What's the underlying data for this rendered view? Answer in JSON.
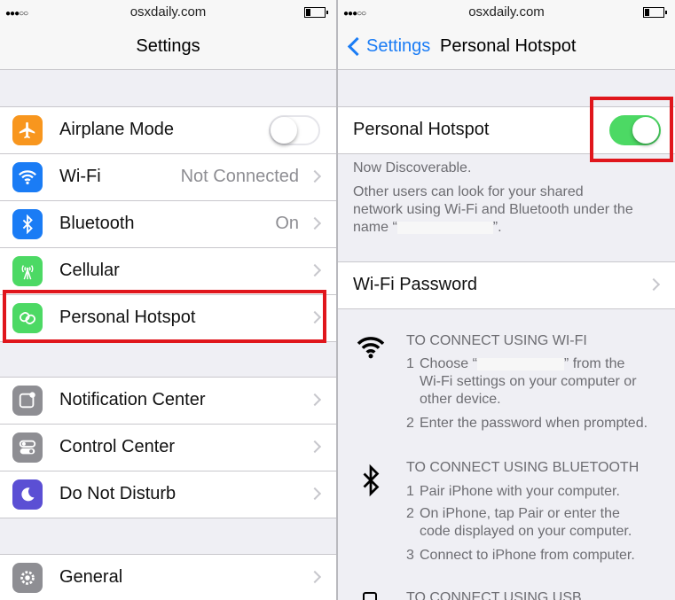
{
  "status": {
    "carrier": "osxdaily.com",
    "signal": "●●●○○"
  },
  "left": {
    "title": "Settings",
    "group1": [
      {
        "label": "Airplane Mode",
        "value": "",
        "icon": "airplane-icon",
        "color": "#f8961e",
        "toggle": true
      },
      {
        "label": "Wi-Fi",
        "value": "Not Connected",
        "icon": "wifi-icon",
        "color": "#1a7cf5"
      },
      {
        "label": "Bluetooth",
        "value": "On",
        "icon": "bluetooth-icon",
        "color": "#1a7cf5"
      },
      {
        "label": "Cellular",
        "value": "",
        "icon": "cellular-icon",
        "color": "#4cd964"
      },
      {
        "label": "Personal Hotspot",
        "value": "",
        "icon": "hotspot-icon",
        "color": "#4cd964"
      }
    ],
    "group2": [
      {
        "label": "Notification Center",
        "icon": "notification-icon",
        "color": "#8e8e93"
      },
      {
        "label": "Control Center",
        "icon": "control-center-icon",
        "color": "#8e8e93"
      },
      {
        "label": "Do Not Disturb",
        "icon": "moon-icon",
        "color": "#5b4fd4"
      }
    ],
    "group3": [
      {
        "label": "General",
        "icon": "gear-icon",
        "color": "#8e8e93"
      }
    ]
  },
  "right": {
    "back_label": "Settings",
    "title": "Personal Hotspot",
    "hotspot_label": "Personal Hotspot",
    "hotspot_on": true,
    "discoverable": "Now Discoverable.",
    "info_line1": "Other users can look for your shared",
    "info_line2": "network using Wi-Fi and Bluetooth under the",
    "info_line3_a": "name “",
    "info_line3_b": "”.",
    "wifi_password_label": "Wi-Fi Password",
    "wifi_section": {
      "heading": "TO CONNECT USING WI-FI",
      "steps": [
        {
          "num": "1",
          "lines": [
            "Choose “",
            "” from the",
            "Wi-Fi settings on your computer or",
            "other device."
          ]
        },
        {
          "num": "2",
          "lines": [
            "Enter the password when prompted."
          ]
        }
      ]
    },
    "bt_section": {
      "heading": "TO CONNECT USING BLUETOOTH",
      "steps": [
        {
          "num": "1",
          "lines": [
            "Pair iPhone with your computer."
          ]
        },
        {
          "num": "2",
          "lines": [
            "On iPhone, tap Pair or enter the",
            "code displayed on your computer."
          ]
        },
        {
          "num": "3",
          "lines": [
            "Connect to iPhone from computer."
          ]
        }
      ]
    },
    "usb_heading": "TO CONNECT USING USB"
  }
}
